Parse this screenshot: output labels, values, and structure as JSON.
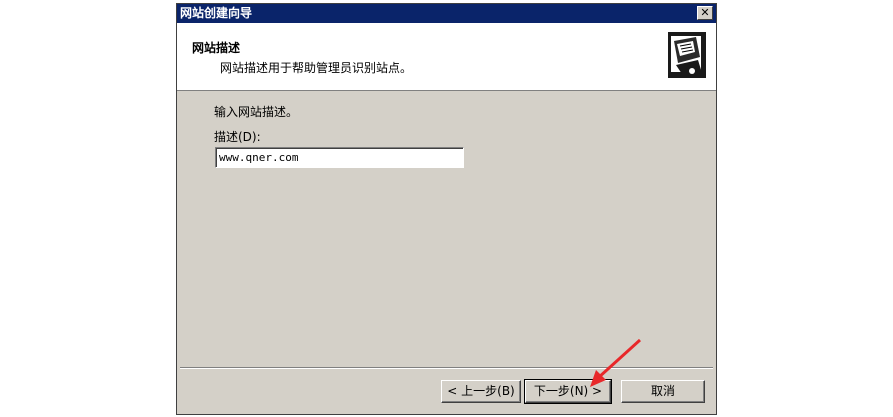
{
  "window": {
    "title": "网站创建向导",
    "close_glyph": "✕"
  },
  "header": {
    "title": "网站描述",
    "subtitle": "网站描述用于帮助管理员识别站点。"
  },
  "main": {
    "prompt": "输入网站描述。",
    "description_label": "描述(D):",
    "description_value": "www.qner.com"
  },
  "buttons": {
    "back_label": "< 上一步(B)",
    "next_label": "下一步(N) >",
    "cancel_label": "取消"
  },
  "icons": {
    "header_icon": "book-document-icon",
    "annotation": "red-arrow-annotation"
  },
  "colors": {
    "titlebar": "#0a246a",
    "dialog_bg": "#d4d0c8",
    "annotation_arrow": "#e8282a"
  }
}
